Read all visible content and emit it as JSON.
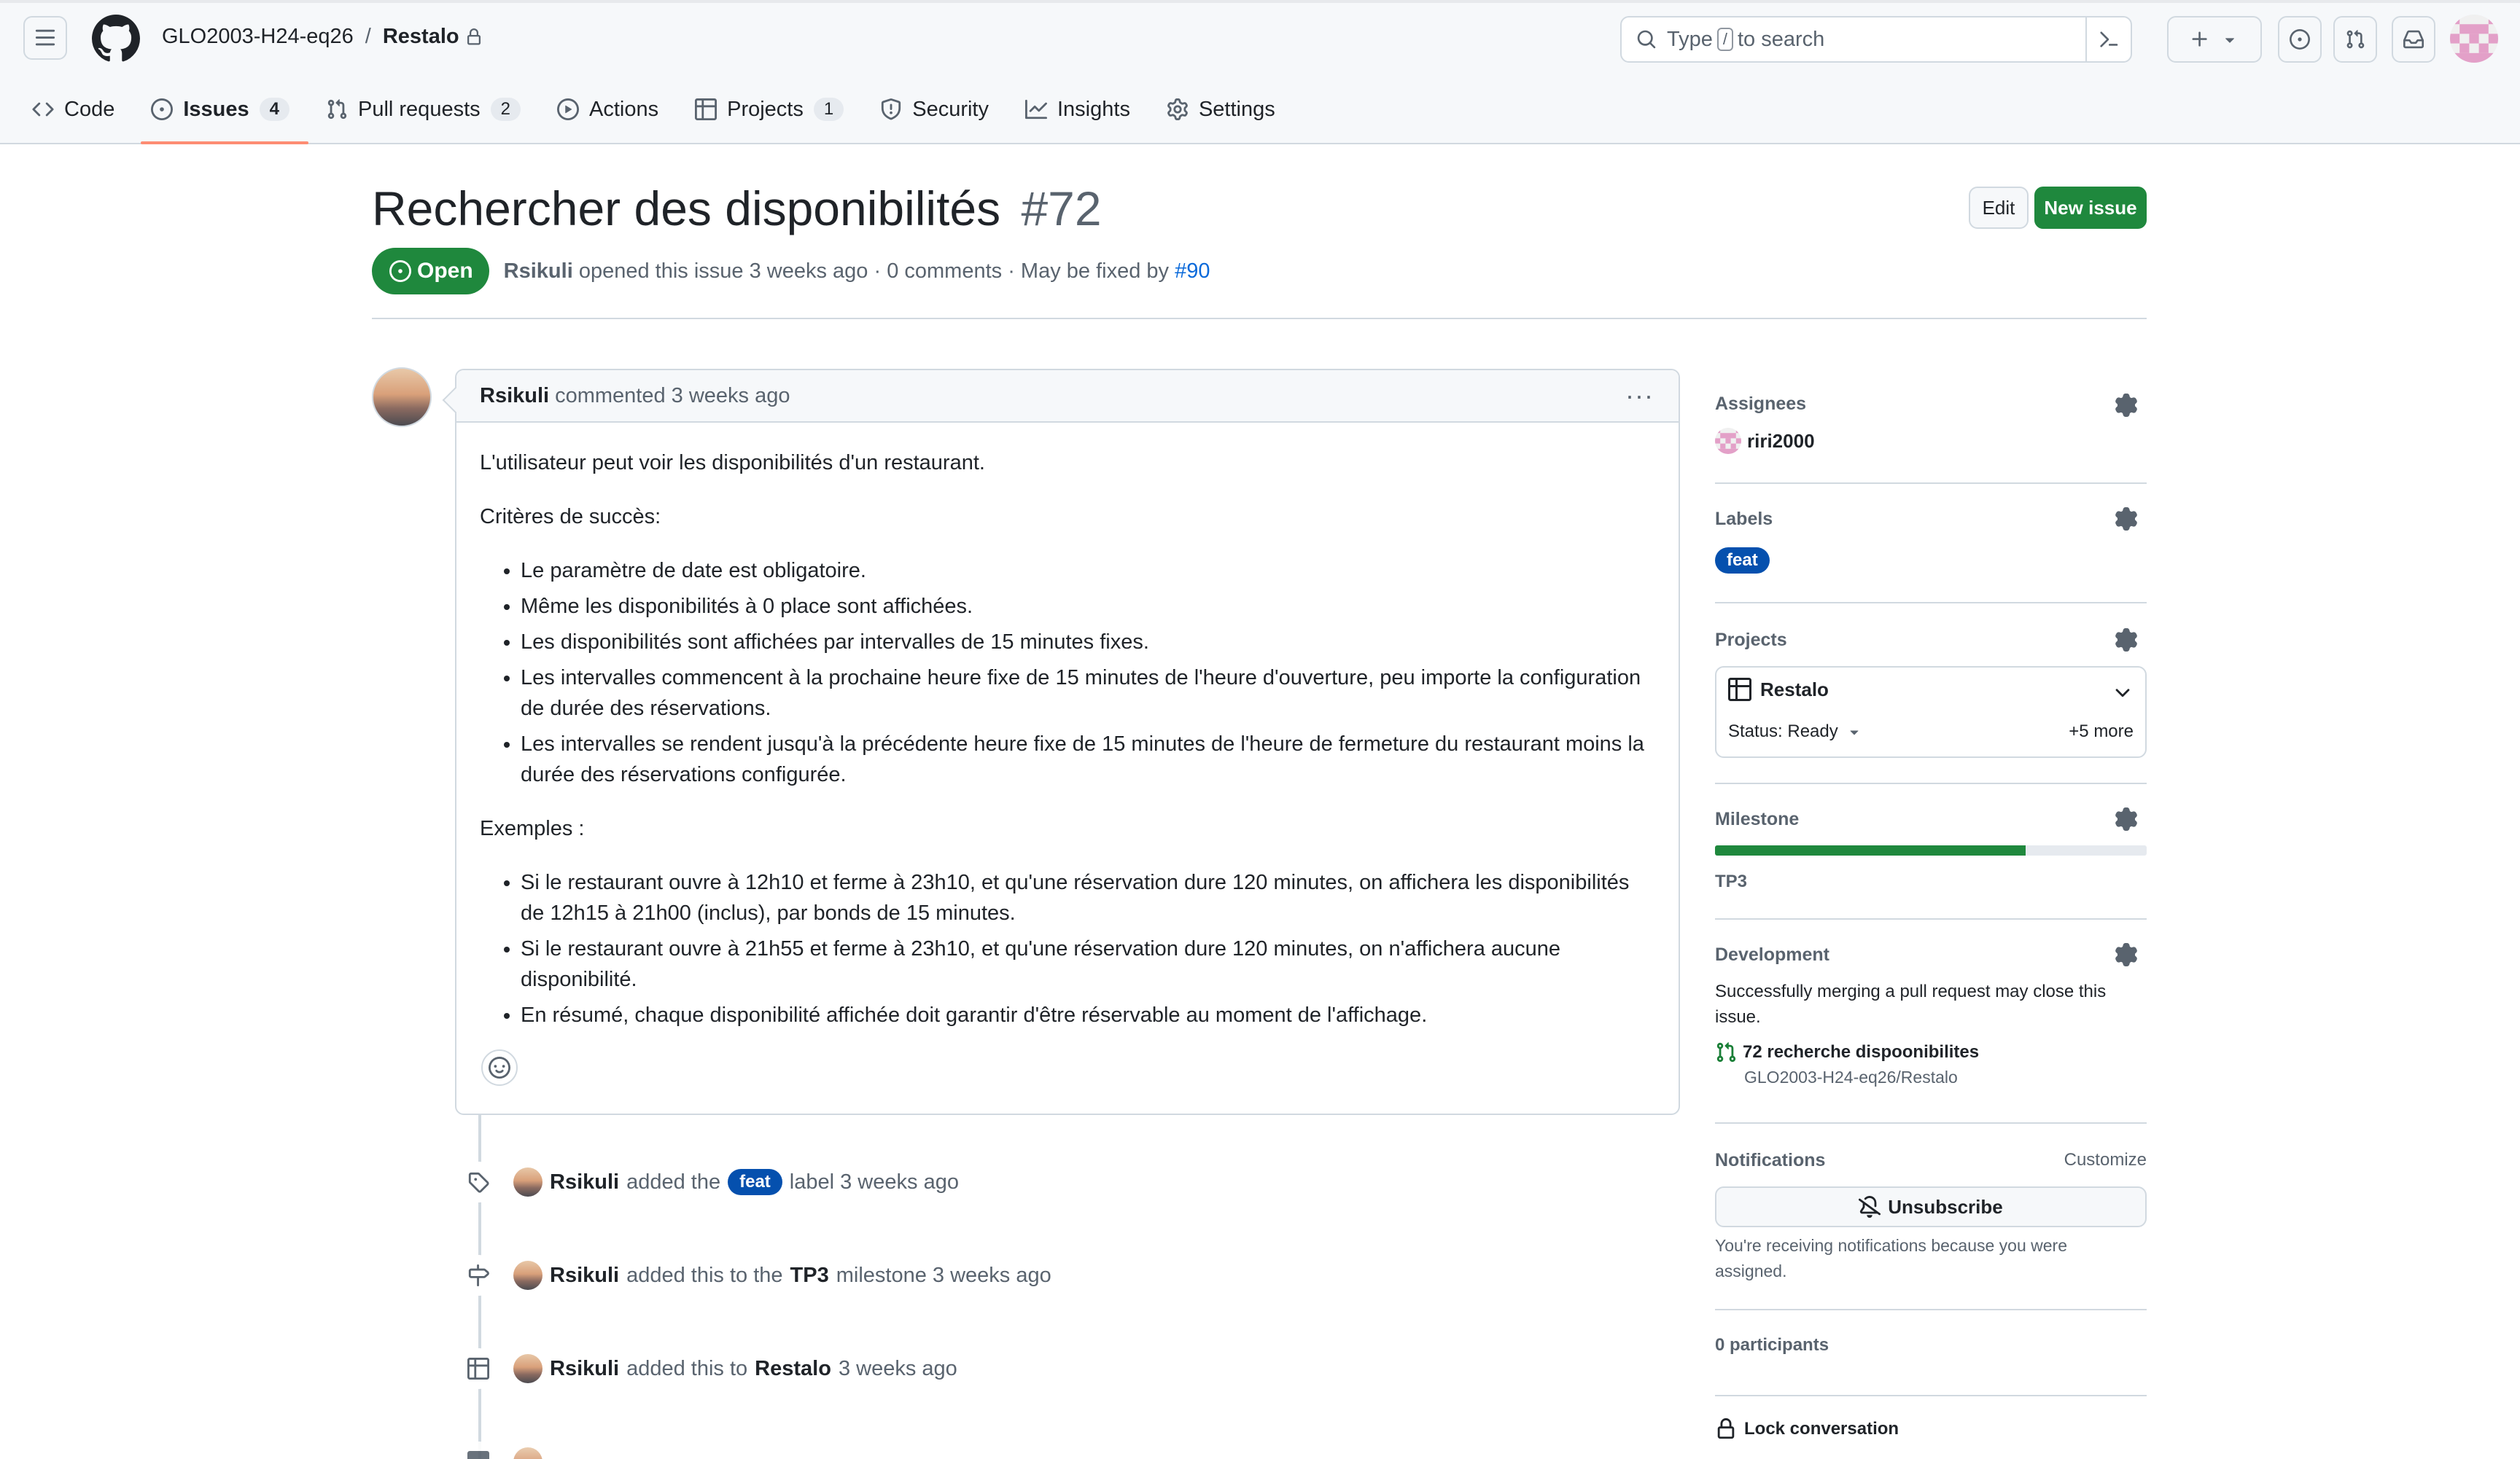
{
  "header": {
    "owner": "GLO2003-H24-eq26",
    "separator": "/",
    "repo": "Restalo",
    "search": {
      "prefix": "Type",
      "key": "/",
      "suffix": "to search"
    }
  },
  "repo_nav": {
    "code": "Code",
    "issues": "Issues",
    "issues_count": "4",
    "pull_requests": "Pull requests",
    "pull_requests_count": "2",
    "actions": "Actions",
    "projects": "Projects",
    "projects_count": "1",
    "security": "Security",
    "insights": "Insights",
    "settings": "Settings"
  },
  "issue": {
    "title": "Rechercher des disponibilités",
    "number": "#72",
    "edit_label": "Edit",
    "new_issue_label": "New issue",
    "state": "Open",
    "author": "Rsikuli",
    "opened_text": "opened this issue 3 weeks ago · 0 comments · May be fixed by",
    "fixed_by": "#90"
  },
  "comment": {
    "author": "Rsikuli",
    "meta": "commented 3 weeks ago",
    "menu": "···",
    "intro": "L'utilisateur peut voir les disponibilités d'un restaurant.",
    "criteria_heading": "Critères de succès:",
    "criteria": [
      "Le paramètre de date est obligatoire.",
      "Même les disponibilités à 0 place sont affichées.",
      "Les disponibilités sont affichées par intervalles de 15 minutes fixes.",
      "Les intervalles commencent à la prochaine heure fixe de 15 minutes de l'heure d'ouverture, peu importe la configuration de durée des réservations.",
      "Les intervalles se rendent jusqu'à la précédente heure fixe de 15 minutes de l'heure de fermeture du restaurant moins la durée des réservations configurée."
    ],
    "examples_heading": "Exemples :",
    "examples": [
      "Si le restaurant ouvre à 12h10 et ferme à 23h10, et qu'une réservation dure 120 minutes, on affichera les disponibilités de 12h15 à 21h00 (inclus), par bonds de 15 minutes.",
      "Si le restaurant ouvre à 21h55 et ferme à 23h10, et qu'une réservation dure 120 minutes, on n'affichera aucune disponibilité.",
      "En résumé, chaque disponibilité affichée doit garantir d'être réservable au moment de l'affichage."
    ]
  },
  "timeline": [
    {
      "actor": "Rsikuli",
      "pre": "added the",
      "label": "feat",
      "post": "label 3 weeks ago"
    },
    {
      "actor": "Rsikuli",
      "pre": "added this to the",
      "strong": "TP3",
      "post": "milestone 3 weeks ago"
    },
    {
      "actor": "Rsikuli",
      "pre": "added this to",
      "strong": "Restalo",
      "post": "3 weeks ago"
    }
  ],
  "sidebar": {
    "assignees_title": "Assignees",
    "assignee": "riri2000",
    "labels_title": "Labels",
    "label": "feat",
    "projects_title": "Projects",
    "project_name": "Restalo",
    "project_status": "Status: Ready",
    "project_more": "+5 more",
    "milestone_title": "Milestone",
    "milestone_name": "TP3",
    "milestone_progress": 0.72,
    "development_title": "Development",
    "development_text": "Successfully merging a pull request may close this issue.",
    "pr_title": "72 recherche dispoonibilites",
    "pr_repo": "GLO2003-H24-eq26/Restalo",
    "notifications_title": "Notifications",
    "customize": "Customize",
    "unsubscribe": "Unsubscribe",
    "notif_text": "You're receiving notifications because you were assigned.",
    "participants": "0 participants",
    "lock": "Lock conversation"
  },
  "colors": {
    "accent_green": "#1f883d",
    "label_blue": "#0550ae",
    "link": "#0969da",
    "tab_underline": "#fd8c73"
  }
}
